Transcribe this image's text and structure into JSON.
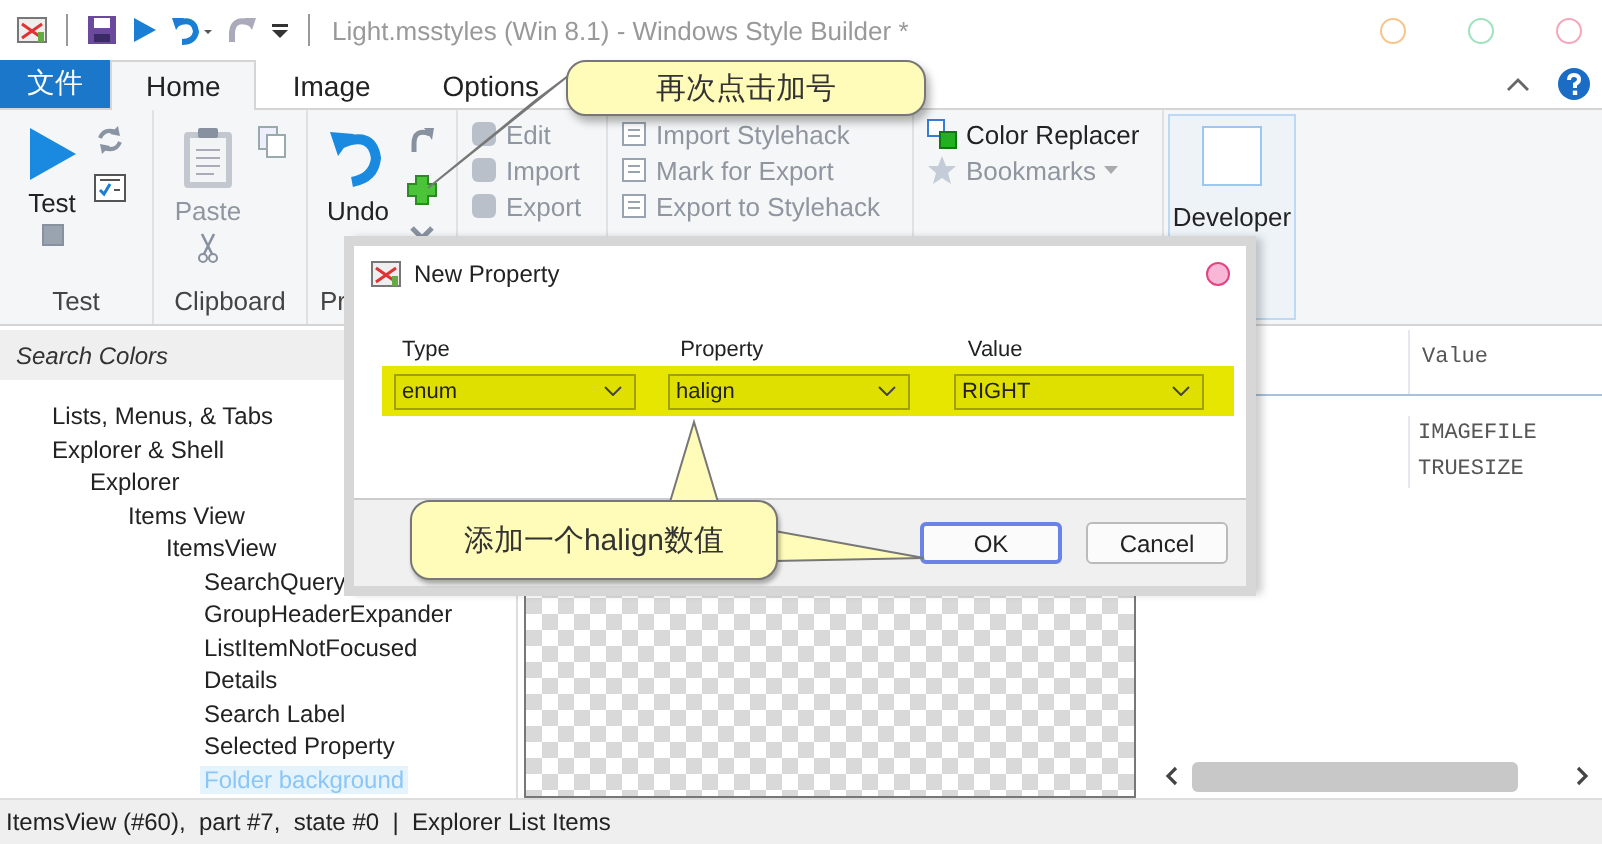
{
  "title_bar": {
    "title": "Light.msstyles (Win 8.1) - Windows Style Builder *"
  },
  "tabs": [
    {
      "label": "文件",
      "kind": "file"
    },
    {
      "label": "Home",
      "kind": "tab",
      "selected": true
    },
    {
      "label": "Image",
      "kind": "tab",
      "selected": false
    },
    {
      "label": "Options",
      "kind": "tab",
      "selected": false
    }
  ],
  "ribbon": {
    "test": {
      "label": "Test",
      "run": "Test"
    },
    "clipboard": {
      "label": "Clipboard",
      "paste": {
        "label": "Paste",
        "disabled": true
      }
    },
    "properties": {
      "label": "Pr",
      "undo": {
        "label": "Undo",
        "disabled": false
      }
    },
    "edit": [
      {
        "label": "Edit",
        "disabled": true
      },
      {
        "label": "Import",
        "disabled": true
      },
      {
        "label": "Export",
        "disabled": true
      }
    ],
    "stylehack": [
      {
        "label": "Import Stylehack",
        "disabled": true
      },
      {
        "label": "Mark for Export",
        "disabled": true
      },
      {
        "label": "Export to Stylehack",
        "disabled": true
      }
    ],
    "tools": [
      {
        "label": "Color Replacer",
        "disabled": false
      },
      {
        "label": "Bookmarks",
        "disabled": true
      }
    ],
    "developer": {
      "label": "Developer"
    }
  },
  "search": {
    "placeholder": "Search Colors"
  },
  "tree": [
    {
      "label": "Lists, Menus, & Tabs",
      "selected": false
    },
    {
      "label": "Explorer & Shell",
      "selected": false,
      "children": [
        {
          "label": "Explorer",
          "selected": false,
          "children": [
            {
              "label": "Items View",
              "selected": false,
              "children": [
                {
                  "label": "ItemsView",
                  "selected": false,
                  "children": [
                    {
                      "label": "SearchQuery",
                      "selected": false
                    },
                    {
                      "label": "GroupHeaderExpander",
                      "selected": false
                    },
                    {
                      "label": "ListItemNotFocused",
                      "selected": false
                    },
                    {
                      "label": "Details",
                      "selected": false
                    },
                    {
                      "label": "Search Label",
                      "selected": false
                    },
                    {
                      "label": "Selected Property",
                      "selected": false
                    },
                    {
                      "label": "Folder background",
                      "selected": true
                    }
                  ]
                }
              ]
            }
          ]
        }
      ]
    }
  ],
  "properties_table": {
    "columns": [
      "Value"
    ],
    "rows": [
      [
        "IMAGEFILE"
      ],
      [
        "TRUESIZE"
      ]
    ]
  },
  "status_bar": "ItemsView (#60),  part #7,  state #0  |  Explorer List Items",
  "dialog": {
    "title": "New Property",
    "fields": [
      {
        "label": "Type",
        "value": "enum"
      },
      {
        "label": "Property",
        "value": "halign"
      },
      {
        "label": "Value",
        "value": "RIGHT"
      }
    ],
    "buttons": [
      {
        "label": "OK",
        "selected": true
      },
      {
        "label": "Cancel",
        "selected": false
      }
    ]
  },
  "callouts": [
    {
      "text": "再次点击加号"
    },
    {
      "text": "添加一个halign数值"
    }
  ]
}
